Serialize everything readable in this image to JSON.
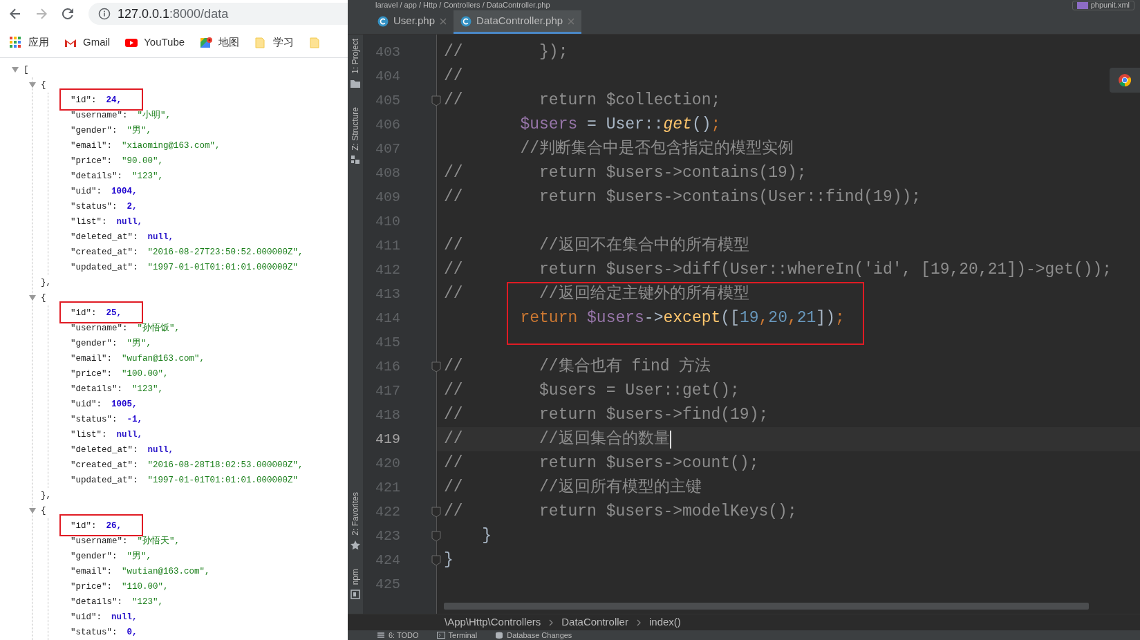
{
  "browser": {
    "nav": [
      {
        "kind": "back",
        "disabled": false
      },
      {
        "kind": "forward",
        "disabled": true
      },
      {
        "kind": "reload",
        "disabled": false
      }
    ],
    "address": {
      "host": "127.0.0.1",
      "path": ":8000/data"
    },
    "bookmarks": [
      {
        "kind": "apps",
        "label": "应用"
      },
      {
        "kind": "gmail",
        "label": "Gmail"
      },
      {
        "kind": "youtube",
        "label": "YouTube"
      },
      {
        "kind": "maps",
        "label": "地图"
      },
      {
        "kind": "folder",
        "label": "学习"
      },
      {
        "kind": "folder"
      }
    ],
    "json_view": {
      "open": "[",
      "expanded": true,
      "objects": [
        {
          "open": "{",
          "expanded": true,
          "close": "},",
          "fields": [
            {
              "key": "\"id\":",
              "value": "24,",
              "kind": "number",
              "boxed": true
            },
            {
              "key": "\"username\":",
              "value": "\"小明\",",
              "kind": "string",
              "boxed": false
            },
            {
              "key": "\"gender\":",
              "value": "\"男\",",
              "kind": "string",
              "boxed": false
            },
            {
              "key": "\"email\":",
              "value": "\"xiaoming@163.com\",",
              "kind": "string",
              "boxed": false
            },
            {
              "key": "\"price\":",
              "value": "\"90.00\",",
              "kind": "string",
              "boxed": false
            },
            {
              "key": "\"details\":",
              "value": "\"123\",",
              "kind": "string",
              "boxed": false
            },
            {
              "key": "\"uid\":",
              "value": "1004,",
              "kind": "number",
              "boxed": false
            },
            {
              "key": "\"status\":",
              "value": "2,",
              "kind": "number",
              "boxed": false
            },
            {
              "key": "\"list\":",
              "value": "null,",
              "kind": "null",
              "boxed": false
            },
            {
              "key": "\"deleted_at\":",
              "value": "null,",
              "kind": "null",
              "boxed": false
            },
            {
              "key": "\"created_at\":",
              "value": "\"2016-08-27T23:50:52.000000Z\",",
              "kind": "string",
              "boxed": false
            },
            {
              "key": "\"updated_at\":",
              "value": "\"1997-01-01T01:01:01.000000Z\"",
              "kind": "string",
              "boxed": false
            }
          ]
        },
        {
          "open": "{",
          "expanded": true,
          "close": "},",
          "fields": [
            {
              "key": "\"id\":",
              "value": "25,",
              "kind": "number",
              "boxed": true
            },
            {
              "key": "\"username\":",
              "value": "\"孙悟饭\",",
              "kind": "string",
              "boxed": false
            },
            {
              "key": "\"gender\":",
              "value": "\"男\",",
              "kind": "string",
              "boxed": false
            },
            {
              "key": "\"email\":",
              "value": "\"wufan@163.com\",",
              "kind": "string",
              "boxed": false
            },
            {
              "key": "\"price\":",
              "value": "\"100.00\",",
              "kind": "string",
              "boxed": false
            },
            {
              "key": "\"details\":",
              "value": "\"123\",",
              "kind": "string",
              "boxed": false
            },
            {
              "key": "\"uid\":",
              "value": "1005,",
              "kind": "number",
              "boxed": false
            },
            {
              "key": "\"status\":",
              "value": "-1,",
              "kind": "number",
              "boxed": false
            },
            {
              "key": "\"list\":",
              "value": "null,",
              "kind": "null",
              "boxed": false
            },
            {
              "key": "\"deleted_at\":",
              "value": "null,",
              "kind": "null",
              "boxed": false
            },
            {
              "key": "\"created_at\":",
              "value": "\"2016-08-28T18:02:53.000000Z\",",
              "kind": "string",
              "boxed": false
            },
            {
              "key": "\"updated_at\":",
              "value": "\"1997-01-01T01:01:01.000000Z\"",
              "kind": "string",
              "boxed": false
            }
          ]
        },
        {
          "open": "{",
          "expanded": true,
          "fields": [
            {
              "key": "\"id\":",
              "value": "26,",
              "kind": "number",
              "boxed": true
            },
            {
              "key": "\"username\":",
              "value": "\"孙悟天\",",
              "kind": "string",
              "boxed": false
            },
            {
              "key": "\"gender\":",
              "value": "\"男\",",
              "kind": "string",
              "boxed": false
            },
            {
              "key": "\"email\":",
              "value": "\"wutian@163.com\",",
              "kind": "string",
              "boxed": false
            },
            {
              "key": "\"price\":",
              "value": "\"110.00\",",
              "kind": "string",
              "boxed": false
            },
            {
              "key": "\"details\":",
              "value": "\"123\",",
              "kind": "string",
              "boxed": false
            },
            {
              "key": "\"uid\":",
              "value": "null,",
              "kind": "null",
              "boxed": false
            },
            {
              "key": "\"status\":",
              "value": "0,",
              "kind": "number",
              "boxed": false
            }
          ]
        }
      ]
    }
  },
  "editor": {
    "path": "laravel / app / Http / Controllers / DataController.php",
    "run_config": "phpunit.xml",
    "tabs": [
      {
        "label": "User.php",
        "selected": false
      },
      {
        "label": "DataController.php",
        "selected": true
      }
    ],
    "tool_strip": [
      {
        "kind": "project",
        "label": "1: Project"
      },
      {
        "kind": "structure",
        "label": "Z: Structure"
      },
      {
        "kind": "favorites",
        "label": "2: Favorites"
      },
      {
        "kind": "npm",
        "label": "npm"
      }
    ],
    "lines": [
      {
        "number": "403",
        "fold": false,
        "current": false,
        "boxed": false,
        "tokens": [
          {
            "kind": "comment",
            "text": "//        });"
          }
        ]
      },
      {
        "number": "404",
        "fold": false,
        "current": false,
        "boxed": false,
        "tokens": [
          {
            "kind": "comment",
            "text": "//"
          }
        ]
      },
      {
        "number": "405",
        "fold": true,
        "current": false,
        "boxed": false,
        "tokens": [
          {
            "kind": "comment",
            "text": "//        return $collection;"
          }
        ]
      },
      {
        "number": "406",
        "fold": false,
        "current": false,
        "boxed": false,
        "tokens": [
          {
            "kind": "var",
            "text": "        $users"
          },
          {
            "kind": "plain",
            "text": " = User::"
          },
          {
            "kind": "fn",
            "text": "get"
          },
          {
            "kind": "plain",
            "text": "()"
          },
          {
            "kind": "punct",
            "text": ";"
          }
        ]
      },
      {
        "number": "407",
        "fold": false,
        "current": false,
        "boxed": false,
        "tokens": [
          {
            "kind": "comment",
            "text": "        //判断集合中是否包含指定的模型实例"
          }
        ]
      },
      {
        "number": "408",
        "fold": false,
        "current": false,
        "boxed": false,
        "tokens": [
          {
            "kind": "comment",
            "text": "//        return $users->contains(19);"
          }
        ]
      },
      {
        "number": "409",
        "fold": false,
        "current": false,
        "boxed": false,
        "tokens": [
          {
            "kind": "comment",
            "text": "//        return $users->contains(User::find(19));"
          }
        ]
      },
      {
        "number": "410",
        "fold": false,
        "current": false,
        "boxed": false
      },
      {
        "number": "411",
        "fold": false,
        "current": false,
        "boxed": false,
        "tokens": [
          {
            "kind": "comment",
            "text": "//        //返回不在集合中的所有模型"
          }
        ]
      },
      {
        "number": "412",
        "fold": false,
        "current": false,
        "boxed": false,
        "tokens": [
          {
            "kind": "comment",
            "text": "//        return $users->diff(User::whereIn('id', [19,20,21])->get());"
          }
        ]
      },
      {
        "number": "413",
        "fold": false,
        "current": false,
        "boxed": true,
        "tokens": [
          {
            "kind": "comment",
            "text": "//        //返回给定主键外的所有模型"
          }
        ]
      },
      {
        "number": "414",
        "fold": false,
        "current": false,
        "boxed": true,
        "tokens": [
          {
            "kind": "kw",
            "text": "        return"
          },
          {
            "kind": "var",
            "text": " $users"
          },
          {
            "kind": "plain",
            "text": "->"
          },
          {
            "kind": "call",
            "text": "except"
          },
          {
            "kind": "plain",
            "text": "(["
          },
          {
            "kind": "num",
            "text": "19"
          },
          {
            "kind": "punct",
            "text": ","
          },
          {
            "kind": "num",
            "text": "20"
          },
          {
            "kind": "punct",
            "text": ","
          },
          {
            "kind": "num",
            "text": "21"
          },
          {
            "kind": "plain",
            "text": "])"
          },
          {
            "kind": "punct",
            "text": ";"
          }
        ]
      },
      {
        "number": "415",
        "fold": false,
        "current": false,
        "boxed": true
      },
      {
        "number": "416",
        "fold": true,
        "current": false,
        "boxed": false,
        "tokens": [
          {
            "kind": "comment",
            "text": "//        //集合也有 find 方法"
          }
        ]
      },
      {
        "number": "417",
        "fold": false,
        "current": false,
        "boxed": false,
        "tokens": [
          {
            "kind": "comment",
            "text": "//        $users = User::get();"
          }
        ]
      },
      {
        "number": "418",
        "fold": false,
        "current": false,
        "boxed": false,
        "tokens": [
          {
            "kind": "comment",
            "text": "//        return $users->find(19);"
          }
        ]
      },
      {
        "number": "419",
        "fold": false,
        "current": true,
        "boxed": false,
        "tokens": [
          {
            "kind": "comment",
            "text": "//        //返回集合的数量"
          }
        ]
      },
      {
        "number": "420",
        "fold": false,
        "current": false,
        "boxed": false,
        "tokens": [
          {
            "kind": "comment",
            "text": "//        return $users->count();"
          }
        ]
      },
      {
        "number": "421",
        "fold": false,
        "current": false,
        "boxed": false,
        "tokens": [
          {
            "kind": "comment",
            "text": "//        //返回所有模型的主键"
          }
        ]
      },
      {
        "number": "422",
        "fold": true,
        "current": false,
        "boxed": false,
        "tokens": [
          {
            "kind": "comment",
            "text": "//        return $users->modelKeys();"
          }
        ]
      },
      {
        "number": "423",
        "fold": true,
        "current": false,
        "boxed": false,
        "tokens": [
          {
            "kind": "plain",
            "text": "    }"
          }
        ]
      },
      {
        "number": "424",
        "fold": true,
        "current": false,
        "boxed": false,
        "tokens": [
          {
            "kind": "plain",
            "text": "}"
          }
        ]
      },
      {
        "number": "425",
        "fold": false,
        "current": false,
        "boxed": false
      }
    ],
    "breadcrumb": [
      "\\App\\Http\\Controllers",
      "DataController",
      "index()"
    ],
    "bottom_tools": [
      {
        "kind": "todo",
        "label": "6: TODO"
      },
      {
        "kind": "terminal",
        "label": "Terminal"
      },
      {
        "kind": "database",
        "label": "Database Changes"
      }
    ]
  }
}
